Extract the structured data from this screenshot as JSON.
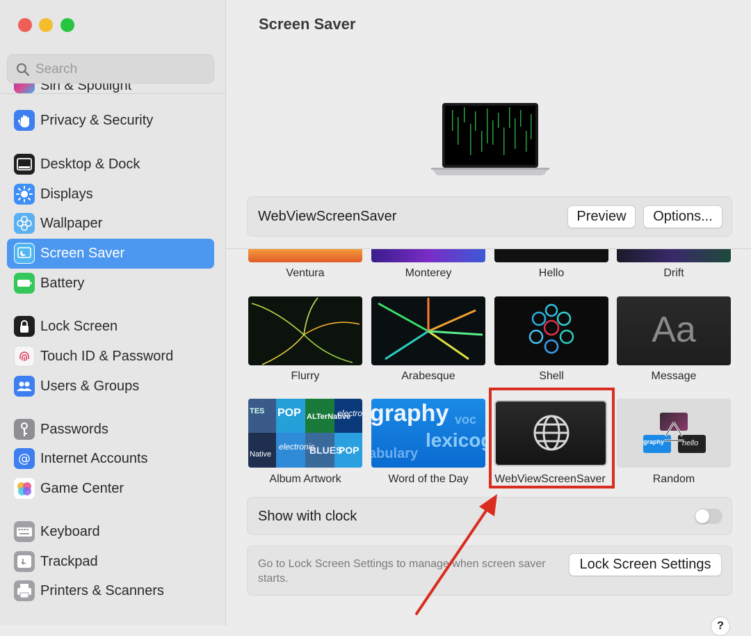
{
  "window": {
    "traffic_lights": [
      {
        "name": "close",
        "color": "#ee5f57"
      },
      {
        "name": "minimize",
        "color": "#f5bd2e"
      },
      {
        "name": "zoom",
        "color": "#28c640"
      }
    ]
  },
  "sidebar": {
    "search_placeholder": "Search",
    "partial_item": "Siri & Spotlight",
    "items": [
      {
        "label": "Privacy & Security",
        "icon": "hand-icon",
        "color": "#3d7ef0"
      },
      {
        "label": "Desktop & Dock",
        "icon": "dock-icon",
        "color": "#1f1f1f"
      },
      {
        "label": "Displays",
        "icon": "sun-icon",
        "color": "#3d8ef5"
      },
      {
        "label": "Wallpaper",
        "icon": "flower-icon",
        "color": "#5ab0f0"
      },
      {
        "label": "Screen Saver",
        "icon": "screen-saver-icon",
        "color": "#4fb6f0",
        "active": true
      },
      {
        "label": "Battery",
        "icon": "battery-icon",
        "color": "#34c759"
      },
      {
        "label": "Lock Screen",
        "icon": "lock-icon",
        "color": "#1f1f1f"
      },
      {
        "label": "Touch ID & Password",
        "icon": "fingerprint-icon",
        "color": "#f2f2f2"
      },
      {
        "label": "Users & Groups",
        "icon": "users-icon",
        "color": "#3d7ef0"
      },
      {
        "label": "Passwords",
        "icon": "key-icon",
        "color": "#8e8e93"
      },
      {
        "label": "Internet Accounts",
        "icon": "at-icon",
        "color": "#3d7ef0"
      },
      {
        "label": "Game Center",
        "icon": "game-center-icon",
        "color": "#ffffff"
      },
      {
        "label": "Keyboard",
        "icon": "keyboard-icon",
        "color": "#9a9a9a"
      },
      {
        "label": "Trackpad",
        "icon": "trackpad-icon",
        "color": "#9a9a9a"
      },
      {
        "label": "Printers & Scanners",
        "icon": "printer-icon",
        "color": "#9a9a9a"
      }
    ]
  },
  "main": {
    "title": "Screen Saver",
    "selected_saver": "WebViewScreenSaver",
    "preview_label": "Preview",
    "options_label": "Options...",
    "savers": [
      {
        "label": "Ventura",
        "style": "ventura"
      },
      {
        "label": "Monterey",
        "style": "monterey"
      },
      {
        "label": "Hello",
        "style": "hello"
      },
      {
        "label": "Drift",
        "style": "drift"
      },
      {
        "label": "Flurry",
        "style": "flurry"
      },
      {
        "label": "Arabesque",
        "style": "arabesque"
      },
      {
        "label": "Shell",
        "style": "shell"
      },
      {
        "label": "Message",
        "style": "message",
        "glyph": "Aa"
      },
      {
        "label": "Album Artwork",
        "style": "album"
      },
      {
        "label": "Word of the Day",
        "style": "word",
        "words": [
          "graphy",
          "voc",
          "lexicog",
          "abulary"
        ]
      },
      {
        "label": "WebViewScreenSaver",
        "style": "webview",
        "selected": true
      },
      {
        "label": "Random",
        "style": "random"
      }
    ],
    "album_words": [
      "POP",
      "ALTerNative",
      "electro",
      "BLUES",
      "electronic",
      "Native",
      "BLUES",
      "POP",
      "TES"
    ],
    "random_mini": [
      "graphy",
      "hello"
    ],
    "clock_label": "Show with clock",
    "clock_on": false,
    "lock_hint": "Go to Lock Screen Settings to manage when screen saver starts.",
    "lock_button": "Lock Screen Settings",
    "help_label": "?"
  }
}
